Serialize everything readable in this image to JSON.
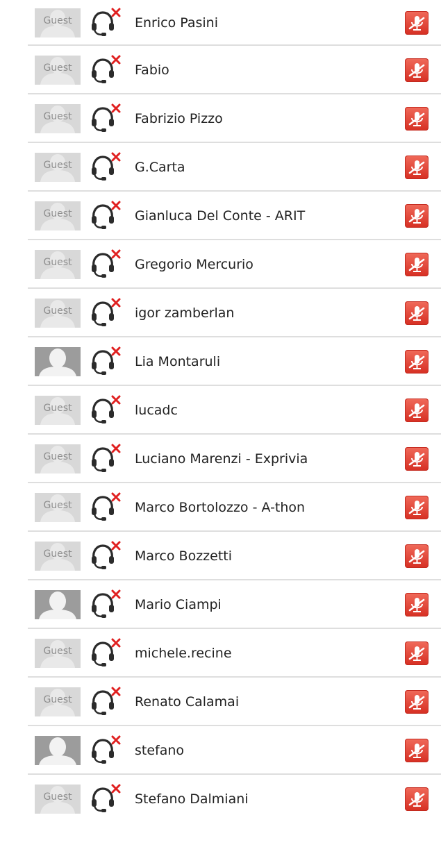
{
  "participants": [
    {
      "name": "Enrico Pasini",
      "avatar": "guest",
      "avatar_text": "Guest",
      "audio_icon": "headset-disconnected-icon",
      "action_icon": "mic-muted-icon"
    },
    {
      "name": "Fabio",
      "avatar": "guest",
      "avatar_text": "Guest",
      "audio_icon": "headset-disconnected-icon",
      "action_icon": "mic-muted-icon"
    },
    {
      "name": "Fabrizio Pizzo",
      "avatar": "guest",
      "avatar_text": "Guest",
      "audio_icon": "headset-disconnected-icon",
      "action_icon": "mic-muted-icon"
    },
    {
      "name": "G.Carta",
      "avatar": "guest",
      "avatar_text": "Guest",
      "audio_icon": "headset-disconnected-icon",
      "action_icon": "mic-muted-icon"
    },
    {
      "name": "Gianluca Del Conte - ARIT",
      "avatar": "guest",
      "avatar_text": "Guest",
      "audio_icon": "headset-disconnected-icon",
      "action_icon": "mic-muted-icon"
    },
    {
      "name": "Gregorio Mercurio",
      "avatar": "guest",
      "avatar_text": "Guest",
      "audio_icon": "headset-disconnected-icon",
      "action_icon": "mic-muted-icon"
    },
    {
      "name": "igor zamberlan",
      "avatar": "guest",
      "avatar_text": "Guest",
      "audio_icon": "headset-disconnected-icon",
      "action_icon": "mic-muted-icon"
    },
    {
      "name": "Lia Montaruli",
      "avatar": "photo",
      "avatar_text": "",
      "audio_icon": "headset-disconnected-icon",
      "action_icon": "mic-muted-icon"
    },
    {
      "name": "lucadc",
      "avatar": "guest",
      "avatar_text": "Guest",
      "audio_icon": "headset-disconnected-icon",
      "action_icon": "mic-muted-icon"
    },
    {
      "name": "Luciano Marenzi - Exprivia",
      "avatar": "guest",
      "avatar_text": "Guest",
      "audio_icon": "headset-disconnected-icon",
      "action_icon": "mic-muted-icon"
    },
    {
      "name": "Marco Bortolozzo - A-thon",
      "avatar": "guest",
      "avatar_text": "Guest",
      "audio_icon": "headset-disconnected-icon",
      "action_icon": "mic-muted-icon"
    },
    {
      "name": "Marco Bozzetti",
      "avatar": "guest",
      "avatar_text": "Guest",
      "audio_icon": "headset-disconnected-icon",
      "action_icon": "mic-muted-icon"
    },
    {
      "name": "Mario Ciampi",
      "avatar": "photo",
      "avatar_text": "",
      "audio_icon": "headset-disconnected-icon",
      "action_icon": "mic-muted-icon"
    },
    {
      "name": "michele.recine",
      "avatar": "guest",
      "avatar_text": "Guest",
      "audio_icon": "headset-disconnected-icon",
      "action_icon": "mic-muted-icon"
    },
    {
      "name": "Renato Calamai",
      "avatar": "guest",
      "avatar_text": "Guest",
      "audio_icon": "headset-disconnected-icon",
      "action_icon": "mic-muted-icon"
    },
    {
      "name": "stefano",
      "avatar": "photo",
      "avatar_text": "",
      "audio_icon": "headset-disconnected-icon",
      "action_icon": "mic-muted-icon"
    },
    {
      "name": "Stefano Dalmiani",
      "avatar": "guest",
      "avatar_text": "Guest",
      "audio_icon": "headset-disconnected-icon",
      "action_icon": "mic-muted-icon"
    }
  ],
  "colors": {
    "mute_button": "#e0443a",
    "disconnect_x": "#e02020",
    "separator": "#dedede"
  }
}
